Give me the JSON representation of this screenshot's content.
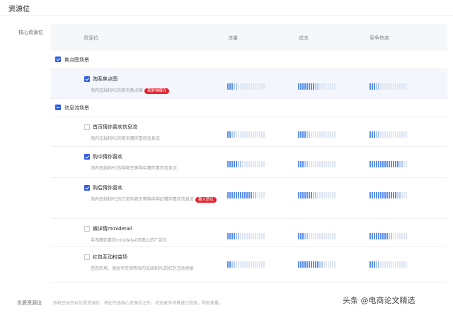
{
  "page": {
    "title": "资源位"
  },
  "core": {
    "label": "核心资源位"
  },
  "table": {
    "headers": {
      "resource": "资源位",
      "traffic": "流量",
      "cost": "成本",
      "competition": "竞争热度"
    }
  },
  "groups": [
    {
      "label": "焦点图场景",
      "state": "checked"
    },
    {
      "label": "信息流场景",
      "state": "partial"
    }
  ],
  "rows": [
    {
      "name": "淘系焦点图",
      "desc": "淘内无线和PC的首页焦点图",
      "badge": "首屏强曝光",
      "checked": true,
      "traffic": 0.3,
      "cost": 0.55,
      "competition": 0.25
    },
    {
      "name": "首页猜你喜欢信息流",
      "desc": "淘内无线和PC的首页猜你喜欢信息流",
      "badge": "",
      "checked": false,
      "traffic": 0.2,
      "cost": 0.35,
      "competition": 0.3
    },
    {
      "name": "购中猜你喜欢",
      "desc": "淘内无线和PC的购物车等购中猜你喜欢信息流",
      "badge": "",
      "checked": true,
      "traffic": 0.4,
      "cost": 0.25,
      "competition": 0.9
    },
    {
      "name": "购后猜你喜欢",
      "desc": "淘内无线和PC的订单列表页等购中购后猜你喜欢信息流",
      "badge": "量大质优",
      "checked": true,
      "traffic": 0.8,
      "cost": 0.5,
      "competition": 0.85
    },
    {
      "name": "微详情minidetail",
      "desc": "手淘猜你喜欢minidetail页面上的广告位",
      "badge": "",
      "checked": false,
      "traffic": 0.35,
      "cost": 0.3,
      "competition": 0.6
    },
    {
      "name": "红包互动权益场",
      "desc": "芭芭农场、淘金币签到等淘内无线和PC的红包互动场景",
      "badge": "",
      "checked": false,
      "traffic": 0.2,
      "cost": 0.65,
      "competition": 0.25
    }
  ],
  "footer": {
    "label": "优质资源位",
    "text": "系统已经开启优质资源位，将在所选核心资源位之外，优选更多场景进行投放，帮助拿量。"
  },
  "watermark": "头条 @电商论文精选"
}
